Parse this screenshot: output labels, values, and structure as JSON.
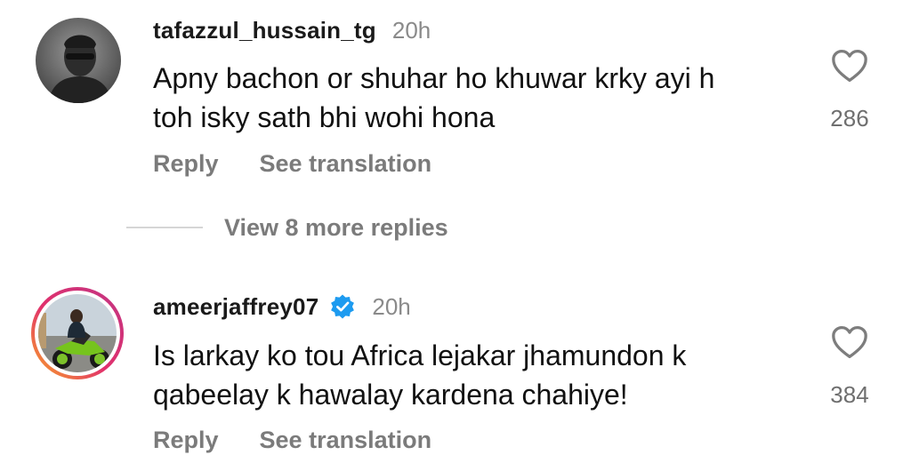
{
  "comments": [
    {
      "username": "tafazzul_hussain_tg",
      "time": "20h",
      "verified": false,
      "text_line1": "Apny bachon or shuhar ho khuwar krky ayi h",
      "text_line2": "toh isky sath bhi wohi hona",
      "likes": "286",
      "reply_label": "Reply",
      "translate_label": "See translation"
    },
    {
      "username": "ameerjaffrey07",
      "time": "20h",
      "verified": true,
      "text_line1": "Is larkay ko tou Africa lejakar jhamundon k",
      "text_line2": "qabeelay k hawalay kardena chahiye!",
      "likes": "384",
      "reply_label": "Reply",
      "translate_label": "See translation"
    }
  ],
  "more_replies_label": "View 8 more replies",
  "colors": {
    "verified_blue": "#1d9bf0",
    "muted_text": "#7b7b7b"
  },
  "icons": {
    "like": "heart-outline-icon",
    "verified": "verified-badge-icon"
  }
}
